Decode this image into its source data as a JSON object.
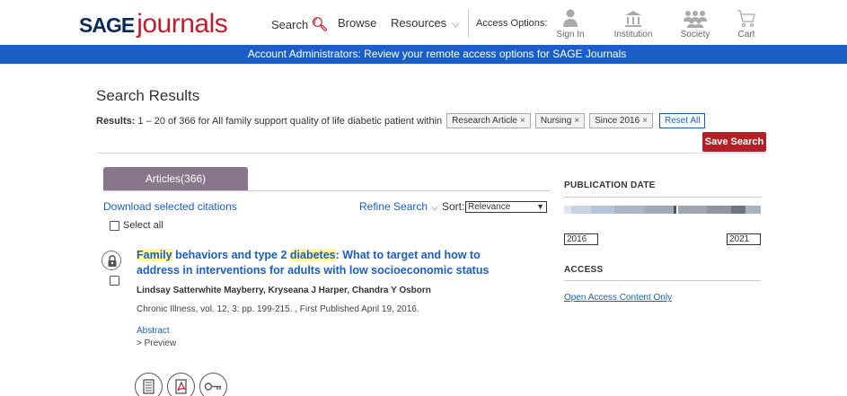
{
  "header": {
    "logo_sage": "SAGE",
    "logo_journals": "journals",
    "nav": {
      "search": "Search",
      "browse": "Browse",
      "resources": "Resources"
    },
    "access_options": "Access Options:",
    "icons": [
      {
        "label": "Sign In",
        "icon": "person-icon"
      },
      {
        "label": "Institution",
        "icon": "institution-icon"
      },
      {
        "label": "Society",
        "icon": "society-icon"
      },
      {
        "label": "Cart",
        "icon": "cart-icon"
      }
    ]
  },
  "banner": {
    "text": "Account Administrators: Review your remote access options for SAGE Journals"
  },
  "search": {
    "title": "Search Results",
    "results_label": "Results:",
    "results_text": "1 – 20 of 366 for All family support quality of life diabetic patient within",
    "filters": [
      "Research Article",
      "Nursing",
      "Since 2016"
    ],
    "reset_label": "Reset All",
    "save_label": "Save Search"
  },
  "tabs": {
    "articles": "Articles(366)"
  },
  "toolbar": {
    "download": "Download selected citations",
    "refine": "Refine Search",
    "sort_label": "Sort:",
    "sort_value": "Relevance",
    "select_all": "Select all"
  },
  "article": {
    "title_hl_1": "Family",
    "title_part_1": " behaviors and type 2 ",
    "title_hl_2": "diabetes",
    "title_part_2": ": What to target and how to address in interventions for adults with low socioeconomic status",
    "authors": "Lindsay Satterwhite Mayberry, Kryseana J Harper, Chandra Y Osborn",
    "journal": "Chronic Illness, vol. 12, 3: pp. 199-215. , First Published April 19, 2016.",
    "abstract": "Abstract",
    "preview": "> Preview"
  },
  "sidebar": {
    "pub_date_heading": "PUBLICATION DATE",
    "year_from": "2016",
    "year_to": "2021",
    "access_heading": "ACCESS",
    "open_access": "Open Access Content Only"
  },
  "colors": {
    "brand_blue": "#1a5fc8",
    "brand_red": "#c41e2e",
    "tab_purple": "#8a768a",
    "save_red": "#b32025",
    "highlight": "#fff59d"
  }
}
